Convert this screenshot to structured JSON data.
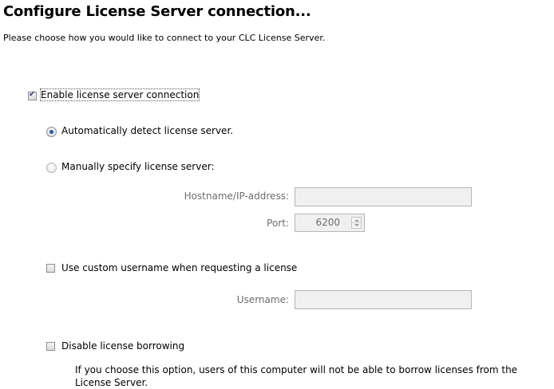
{
  "header": {
    "title": "Configure License Server connection...",
    "subtitle": "Please choose how you would like to connect to your CLC License Server."
  },
  "options": {
    "enable_connection": {
      "label": "Enable license server connection",
      "checked": true
    },
    "auto_detect": {
      "label": "Automatically detect license server.",
      "selected": true
    },
    "manual": {
      "label": "Manually specify license server:",
      "selected": false
    },
    "hostname": {
      "label": "Hostname/IP-address:",
      "value": ""
    },
    "port": {
      "label": "Port:",
      "value": "6200"
    },
    "custom_username": {
      "label": "Use custom username when requesting a license",
      "checked": false
    },
    "username": {
      "label": "Username:",
      "value": ""
    },
    "disable_borrowing": {
      "label": "Disable license borrowing",
      "checked": false,
      "note_line1": "If you choose this option, users of this computer will not be able to borrow licenses from the",
      "note_line2": "License Server."
    }
  }
}
